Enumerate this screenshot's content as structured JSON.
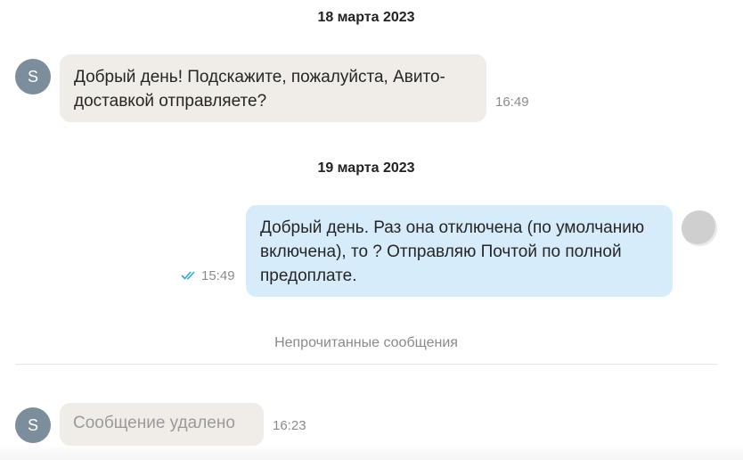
{
  "messages_view": {
    "date_1": "18 марта 2023",
    "msg_1": {
      "avatar_letter": "S",
      "text": "Добрый день! Подскажите, пожалуйста, Авито-доставкой отправляете?",
      "time": "16:49"
    },
    "date_2": "19 марта 2023",
    "msg_2": {
      "text": "Добрый день. Раз она отключена (по умолчанию включена), то ? Отправляю Почтой по полной предоплате.",
      "time": "15:49",
      "status_icon": "double-check-icon"
    },
    "unread_label": "Непрочитанные сообщения",
    "msg_3": {
      "avatar_letter": "S",
      "text": "Сообщение удалено",
      "time": "16:23"
    }
  },
  "colors": {
    "incoming_bubble": "#f0ede8",
    "outgoing_bubble": "#d6ecfb",
    "avatar": "#7c8d9b",
    "read_check": "#2ba8d8"
  }
}
